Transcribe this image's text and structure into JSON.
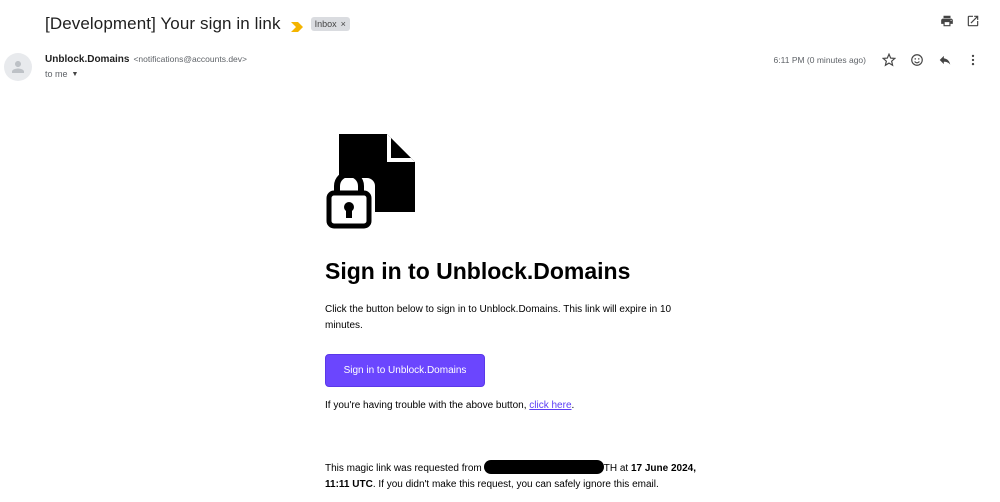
{
  "email": {
    "subject": "[Development] Your sign in link",
    "label_chip": "Inbox",
    "label_chip_close": "×",
    "sender_name": "Unblock.Domains",
    "sender_email": "<notifications@accounts.dev>",
    "recipient": "to me",
    "timestamp": "6:11 PM (0 minutes ago)"
  },
  "body": {
    "headline": "Sign in to Unblock.Domains",
    "intro": "Click the button below to sign in to Unblock.Domains. This link will expire in 10 minutes.",
    "cta_label": "Sign in to Unblock.Domains",
    "trouble_prefix": "If you're having trouble with the above button, ",
    "trouble_link": "click here",
    "trouble_suffix": ".",
    "footer_part1": "This magic link was requested from",
    "footer_part2": "TH at ",
    "footer_date": "17 June 2024, 11:11 UTC",
    "footer_part3": ". If you didn't make this request, you can safely ignore this email."
  },
  "colors": {
    "accent": "#6b46fe",
    "link": "#5b3df5",
    "importance": "#f4b400"
  },
  "icons": {
    "importance": "importance-marker-icon",
    "print": "print-icon",
    "open_new_window": "open-in-new-icon",
    "star": "star-icon",
    "emoji": "emoji-icon",
    "reply": "reply-icon",
    "more": "more-vert-icon",
    "avatar": "person-icon",
    "document_lock": "document-lock-icon"
  }
}
